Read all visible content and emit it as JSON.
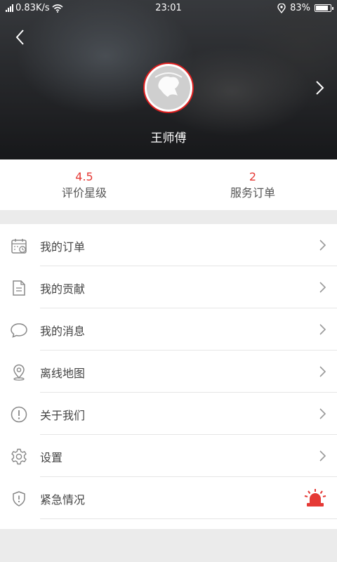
{
  "status_bar": {
    "speed": "0.83K/s",
    "time": "23:01",
    "battery": "83%",
    "battery_level": 0.83
  },
  "header": {
    "driver_name": "王师傅",
    "back_icon": "chevron-left-icon",
    "next_icon": "chevron-right-icon"
  },
  "stats": {
    "rating_value": "4.5",
    "rating_label": "评价星级",
    "orders_value": "2",
    "orders_label": "服务订单"
  },
  "menu": {
    "items": [
      {
        "label": "我的订单",
        "icon": "calendar-icon"
      },
      {
        "label": "我的贡献",
        "icon": "document-icon"
      },
      {
        "label": "我的消息",
        "icon": "chat-bubble-icon"
      },
      {
        "label": "离线地图",
        "icon": "location-pin-icon"
      },
      {
        "label": "关于我们",
        "icon": "exclamation-circle-icon"
      },
      {
        "label": "设置",
        "icon": "gear-icon"
      },
      {
        "label": "紧急情况",
        "icon": "shield-icon"
      }
    ]
  },
  "colors": {
    "accent_red": "#e53935"
  }
}
